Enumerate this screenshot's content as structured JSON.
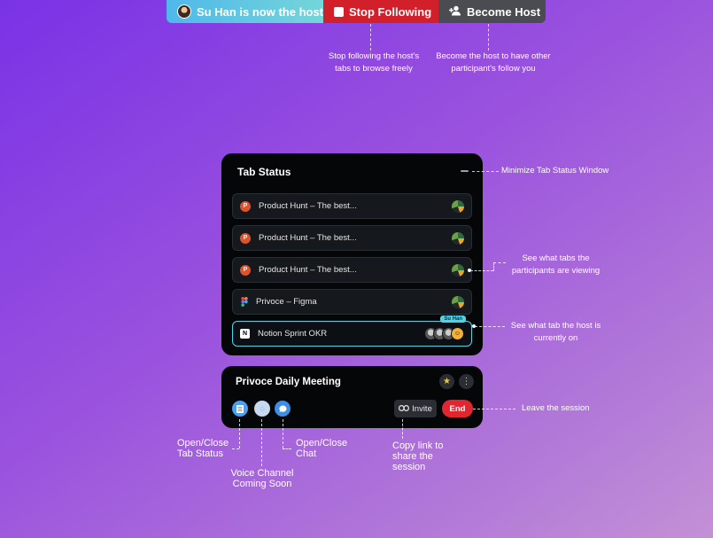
{
  "banner": {
    "host_text": "Su Han is now the host",
    "stop_label": "Stop Following",
    "become_label": "Become Host"
  },
  "annotations": {
    "stop_following": "Stop following the host's tabs to browse freely",
    "become_host": "Become the host to have other participant's follow you",
    "minimize": "Minimize Tab Status Window",
    "participants_tabs": "See what tabs the participants are viewing",
    "host_tab": "See what tab the host is currently on",
    "leave": "Leave the session",
    "open_tab_status": "Open/Close Tab Status",
    "voice_channel": "Voice Channel Coming Soon",
    "open_chat": "Open/Close Chat",
    "copy_link": "Copy link to share the session"
  },
  "tab_status": {
    "title": "Tab Status",
    "host_tag": "Su Han",
    "tabs": [
      {
        "label": "Product Hunt – The best...",
        "icon": "product-hunt-icon"
      },
      {
        "label": "Product Hunt – The best...",
        "icon": "product-hunt-icon"
      },
      {
        "label": "Product Hunt – The best...",
        "icon": "product-hunt-icon"
      },
      {
        "label": "Privoce – Figma",
        "icon": "figma-icon"
      },
      {
        "label": "Notion Sprint OKR",
        "icon": "notion-icon"
      }
    ]
  },
  "meeting": {
    "title": "Privoce Daily Meeting",
    "invite_label": "Invite",
    "end_label": "End"
  }
}
